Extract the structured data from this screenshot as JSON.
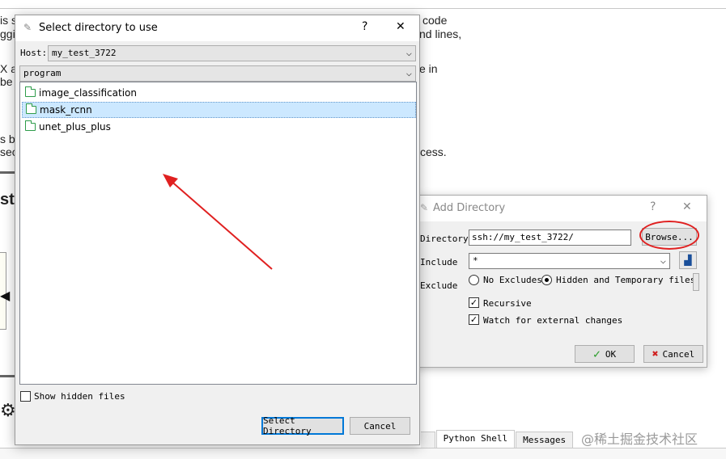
{
  "background": {
    "fragments": [
      "is s",
      "code",
      "ggi",
      "nd lines,",
      "X a",
      "e in",
      "be r",
      "s by",
      "sec",
      "cess.",
      "st"
    ],
    "shell_tabs": [
      "Python Shell",
      "Messages"
    ],
    "watermark": "@稀土掘金技术社区"
  },
  "select_dialog": {
    "title": "Select directory to use",
    "help_label": "?",
    "close_label": "✕",
    "host_label": "Host:",
    "host_value": "my_test_3722",
    "path_value": "program",
    "tree_items": [
      {
        "label": "image_classification",
        "selected": false
      },
      {
        "label": "mask_rcnn",
        "selected": true
      },
      {
        "label": "unet_plus_plus",
        "selected": false
      }
    ],
    "show_hidden_label": "Show hidden files",
    "select_button": "Select Directory",
    "cancel_button": "Cancel"
  },
  "add_dialog": {
    "title": "Add Directory",
    "help_label": "?",
    "close_label": "✕",
    "directory_label": "Directory",
    "directory_value": "ssh://my_test_3722/",
    "browse_button": "Browse...",
    "include_label": "Include",
    "include_value": "*",
    "exclude_label": "Exclude",
    "no_excludes_label": "No Excludes",
    "hidden_temp_label": "Hidden and Temporary files",
    "recursive_label": "Recursive",
    "watch_label": "Watch for external changes",
    "ok_button": "OK",
    "cancel_button": "Cancel",
    "recursive_checked": true,
    "watch_checked": true,
    "exclude_selected": "Hidden and Temporary files"
  },
  "colors": {
    "annotation": "#e02020",
    "selection": "#cce8ff",
    "folder": "#2e9c4a"
  }
}
